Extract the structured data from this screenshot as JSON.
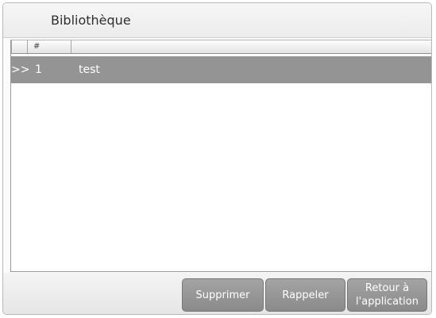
{
  "window": {
    "title": "Bibliothèque"
  },
  "table": {
    "columns": [
      "",
      "#",
      ""
    ],
    "rows": [
      {
        "marker": ">>",
        "index": "1",
        "name": "test",
        "selected": true
      }
    ]
  },
  "footer": {
    "buttons": {
      "delete": "Supprimer",
      "recall": "Rappeler",
      "back": "Retour à\nl'application"
    }
  },
  "colors": {
    "selected_row": "#949494",
    "button_bg": "#999999",
    "window_bg": "#fbfbfb"
  }
}
